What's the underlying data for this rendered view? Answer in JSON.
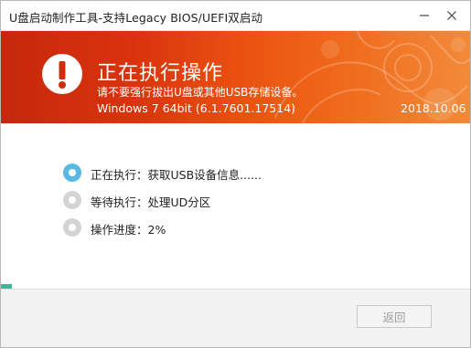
{
  "window": {
    "title": "U盘启动制作工具-支持Legacy BIOS/UEFI双启动",
    "controls": {
      "minimize_icon": "minimize-icon",
      "close_icon": "close-icon"
    }
  },
  "banner": {
    "icon": "warning-icon",
    "title": "正在执行操作",
    "subtitle": "请不要强行拔出U盘或其他USB存储设备。",
    "os_info": "Windows 7 64bit (6.1.7601.17514)",
    "date": "2018.10.06",
    "colors": {
      "start": "#c6280c",
      "end": "#f28a3a"
    }
  },
  "steps": [
    {
      "label": "正在执行：获取USB设备信息......",
      "state": "active"
    },
    {
      "label": "等待执行：处理UD分区",
      "state": "waiting"
    },
    {
      "label": "操作进度：2%",
      "state": "waiting"
    }
  ],
  "progress": {
    "percent": 2,
    "color": "#45b49a"
  },
  "footer": {
    "back_label": "返回",
    "back_enabled": false
  }
}
